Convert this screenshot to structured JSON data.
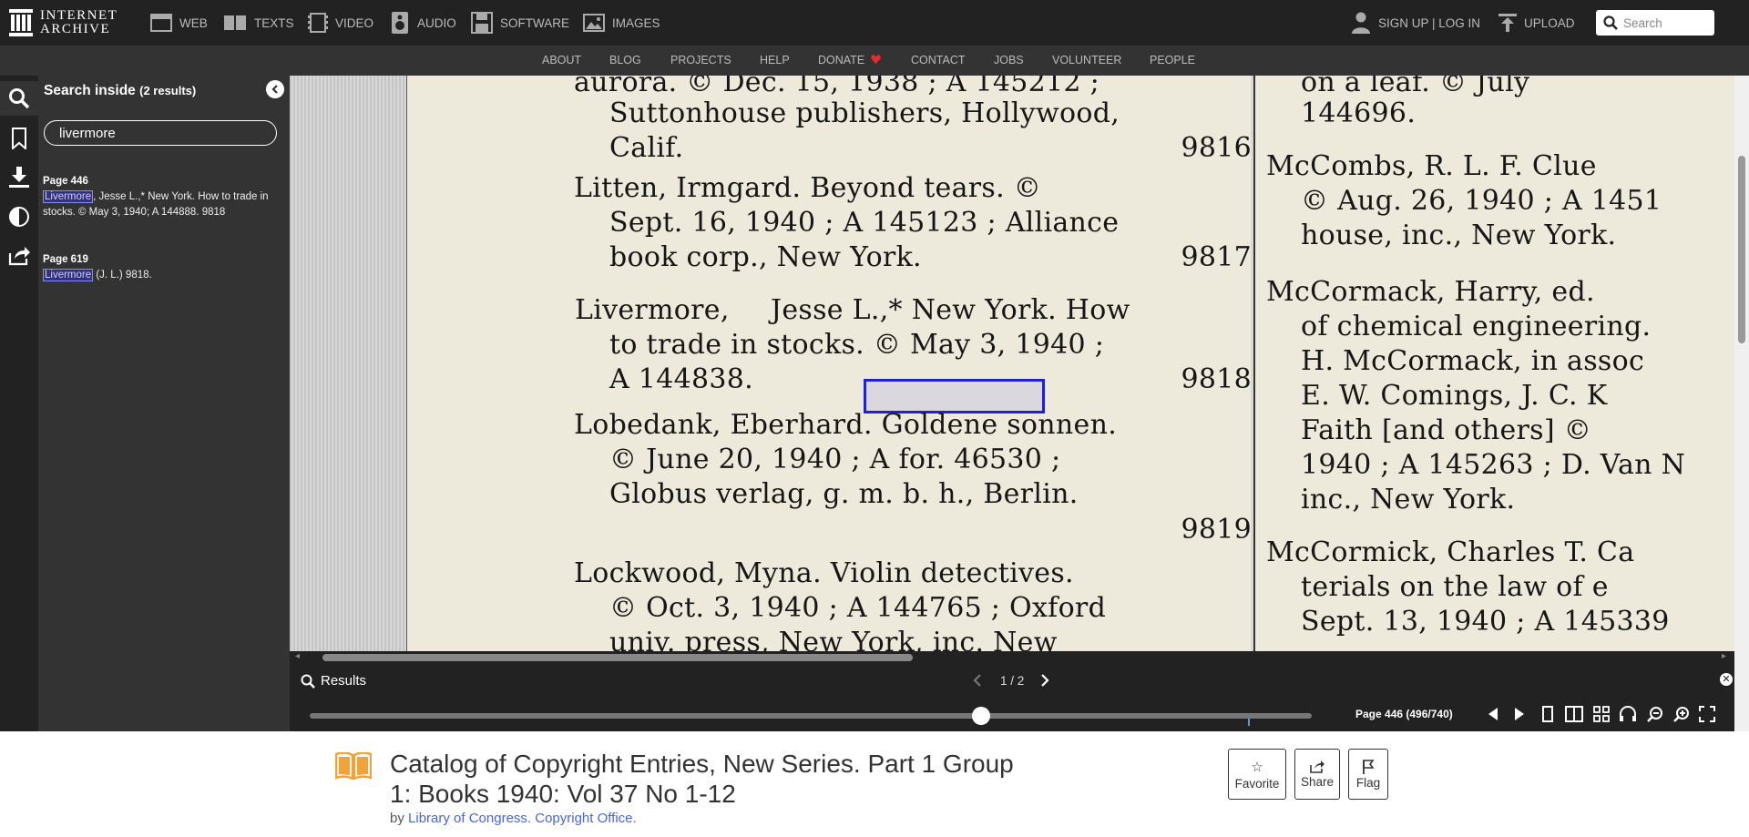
{
  "top_nav": {
    "logo_line1": "INTERNET",
    "logo_line2": "ARCHIVE",
    "items": [
      {
        "label": "WEB",
        "icon": "web-icon"
      },
      {
        "label": "TEXTS",
        "icon": "texts-icon"
      },
      {
        "label": "VIDEO",
        "icon": "video-icon"
      },
      {
        "label": "AUDIO",
        "icon": "audio-icon"
      },
      {
        "label": "SOFTWARE",
        "icon": "software-icon"
      },
      {
        "label": "IMAGES",
        "icon": "images-icon"
      }
    ],
    "signup_label": "SIGN UP | LOG IN",
    "upload_label": "UPLOAD",
    "search_placeholder": "Search"
  },
  "sub_nav": {
    "links": [
      "ABOUT",
      "BLOG",
      "PROJECTS",
      "HELP",
      "DONATE",
      "CONTACT",
      "JOBS",
      "VOLUNTEER",
      "PEOPLE"
    ],
    "donate_heart_color": "#e32d2d"
  },
  "search_panel": {
    "title": "Search inside",
    "count": "(2 results)",
    "query": "livermore",
    "results": [
      {
        "page": "Page 446",
        "match": "Livermore",
        "rest": ", Jesse L.,* New York. How to trade in stocks. © May 3, 1940; A 144888. 9818"
      },
      {
        "page": "Page 619",
        "match": "Livermore",
        "rest": " (J. L.) 9818."
      }
    ]
  },
  "book_page": {
    "left_lines": [
      "aurora.  © Dec. 15, 1938 ; A 145212 ;",
      "Suttonhouse publishers, Hollywood,",
      "Calif.",
      "9816",
      "Litten, Irmgard.  Beyond tears.  ©",
      "Sept. 16, 1940 ; A 145123 ; Alliance",
      "book corp., New York.",
      "9817",
      "Livermore,",
      "Jesse L.,* New York.  How",
      "to trade in stocks.  © May 3, 1940 ;",
      "A 144838.",
      "9818",
      "Lobedank, Eberhard.  Goldene sonnen.",
      "© June 20, 1940 ;  A  for.  46530 ;",
      "Globus verlag, g. m. b. h., Berlin.",
      "9819",
      "Lockwood, Myna.  Violin detectives.",
      "© Oct. 3, 1940 ; A 144765 ; Oxford",
      "univ. press, New York, inc.  New"
    ],
    "right_lines": [
      "on a leaf.  © July",
      "144696.",
      "McCombs, R. L. F.  Clue",
      "© Aug. 26, 1940 ; A 1451",
      "house, inc., New York.",
      "McCormack, Harry, ed.",
      "of chemical engineering.",
      "H. McCormack, in assoc",
      "E. W. Comings, J. C. K",
      "Faith [and others] ©",
      "1940 ; A 145263 ; D. Van N",
      "inc., New York.",
      "McCormick, Charles T.  Ca",
      "terials on the law of e",
      "Sept. 13, 1940 ; A 145339"
    ]
  },
  "results_bar": {
    "label": "Results",
    "counter": "1 / 2"
  },
  "bottom_bar": {
    "page_indicator": "Page 446 (496/740)",
    "progress": 0.67
  },
  "item": {
    "title": "Catalog of Copyright Entries, New Series. Part 1 Group 1: Books 1940: Vol 37 No 1-12",
    "by_prefix": "by",
    "author": "Library of Congress. Copyright Office.",
    "actions": [
      "Favorite",
      "Share",
      "Flag"
    ]
  }
}
